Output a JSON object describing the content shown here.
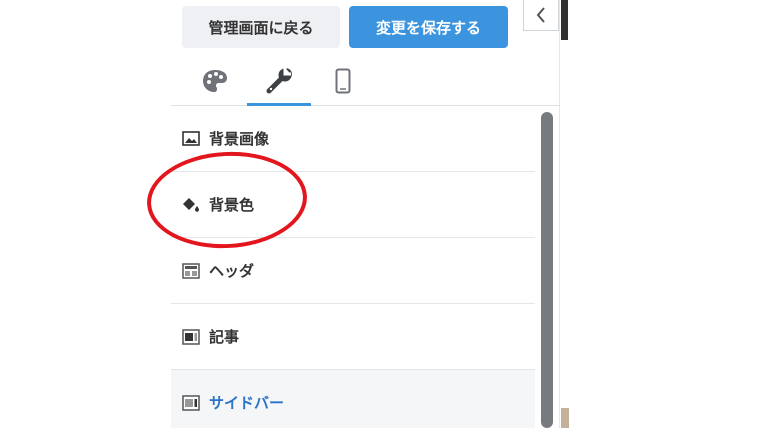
{
  "header": {
    "back_label": "管理画面に戻る",
    "save_label": "変更を保存する",
    "collapse_icon": "chevron-left-icon"
  },
  "tabs": [
    {
      "icon": "palette-icon",
      "active": false
    },
    {
      "icon": "wrench-icon",
      "active": true
    },
    {
      "icon": "smartphone-icon",
      "active": false
    }
  ],
  "menu": {
    "items": [
      {
        "label": "背景画像",
        "icon": "image-icon"
      },
      {
        "label": "背景色",
        "icon": "paint-bucket-icon"
      },
      {
        "label": "ヘッダ",
        "icon": "layout-header-icon"
      },
      {
        "label": "記事",
        "icon": "layout-article-icon"
      },
      {
        "label": "サイドバー",
        "icon": "layout-sidebar-icon",
        "selected": true
      }
    ]
  },
  "colors": {
    "accent": "#3b94dd",
    "selected_text": "#2a73c8",
    "annotation": "#e3161d"
  }
}
